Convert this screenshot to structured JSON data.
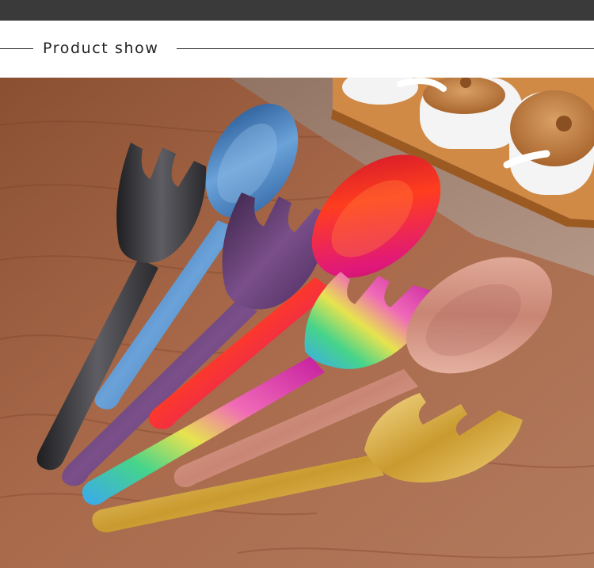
{
  "section": {
    "heading": "Product show"
  },
  "photo": {
    "subject": "colored-serving-utensils",
    "colors": {
      "table": "#9a5d3b",
      "black": "#3b3b3f",
      "blue": "#3e76b8",
      "purple": "#5b3b6b",
      "red": "#d8222e",
      "rainbow_pink": "#d6339e",
      "rose_gold": "#d79a8a",
      "gold": "#e3be5a"
    }
  }
}
